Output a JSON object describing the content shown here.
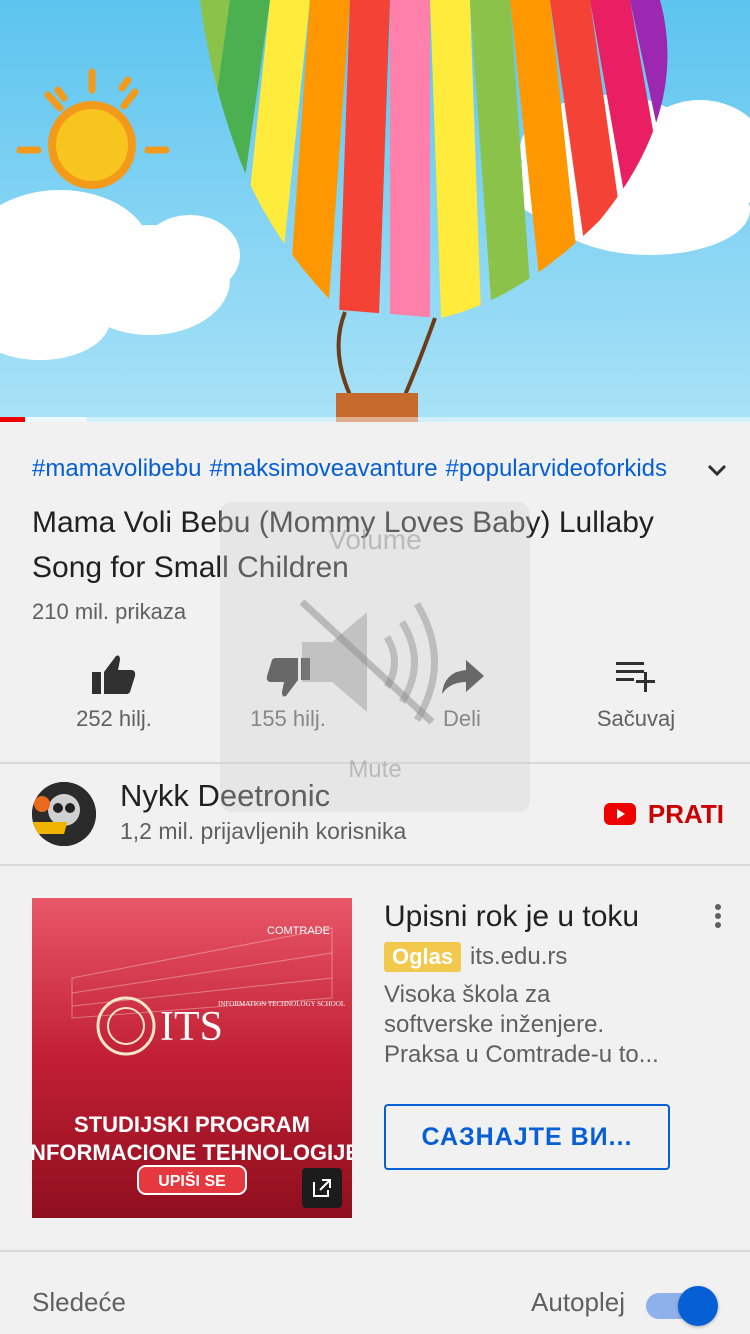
{
  "video": {
    "progress_played": 0.033,
    "progress_buffered": 0.115
  },
  "hashtags": [
    "#mamavolibebu",
    "#maksimoveavanture",
    "#popularvideoforkids"
  ],
  "title": "Mama Voli Bebu (Mommy Loves Baby) Lullaby Song for Small Children",
  "views": "210 mil. prikaza",
  "actions": {
    "like": {
      "label": "252 hilj.",
      "icon": "thumb-up-icon"
    },
    "dislike": {
      "label": "155 hilj.",
      "icon": "thumb-down-icon"
    },
    "share": {
      "label": "Deli",
      "icon": "share-icon"
    },
    "save": {
      "label": "Sačuvaj",
      "icon": "playlist-add-icon"
    }
  },
  "channel": {
    "name": "Nykk Deetronic",
    "subscribers": "1,2 mil. prijavljenih korisnika",
    "subscribe_label": "PRATI"
  },
  "ad": {
    "title": "Upisni rok je u toku",
    "badge": "Oglas",
    "domain": "its.edu.rs",
    "description_lines": [
      "Visoka škola za",
      "softverske inženjere.",
      "Praksa u Comtrade-u to..."
    ],
    "cta": "САЗНАЈТЕ ВИ...",
    "image": {
      "brand": "ITS",
      "brand_sub": "INFORMATION TECHNOLOGY SCHOOL",
      "program_line1": "STUDIJSKI PROGRAM",
      "program_line2": "INFORMACIONE TEHNOLOGIJE",
      "button": "UPIŠI SE",
      "building_sign": "COMTRADE"
    }
  },
  "upnext": {
    "label": "Sledeće",
    "autoplay_label": "Autoplej",
    "autoplay_on": true
  },
  "volume_overlay": {
    "title": "Volume",
    "subtitle": "Mute"
  },
  "colors": {
    "link_blue": "#065fd4",
    "subscribe_red": "#cc0000",
    "badge_yellow": "#f2c94c"
  }
}
